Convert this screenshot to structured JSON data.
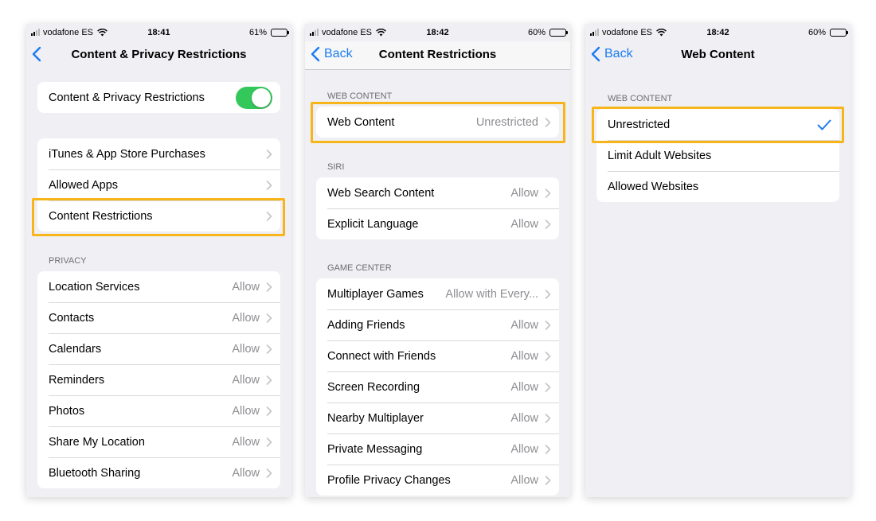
{
  "colors": {
    "accent": "#1a7cf0",
    "toggle_on": "#34c759",
    "highlight": "#f7b519"
  },
  "screens": [
    {
      "status": {
        "carrier": "vodafone ES",
        "time": "18:41",
        "battery_text": "61%",
        "battery_level": 0.61
      },
      "nav": {
        "title": "Content & Privacy Restrictions",
        "back_label": ""
      },
      "toggle_row": {
        "label": "Content & Privacy Restrictions",
        "enabled": true
      },
      "menu": [
        {
          "label": "iTunes & App Store Purchases"
        },
        {
          "label": "Allowed Apps"
        },
        {
          "label": "Content Restrictions"
        }
      ],
      "privacy_header": "PRIVACY",
      "privacy": [
        {
          "label": "Location Services",
          "value": "Allow"
        },
        {
          "label": "Contacts",
          "value": "Allow"
        },
        {
          "label": "Calendars",
          "value": "Allow"
        },
        {
          "label": "Reminders",
          "value": "Allow"
        },
        {
          "label": "Photos",
          "value": "Allow"
        },
        {
          "label": "Share My Location",
          "value": "Allow"
        },
        {
          "label": "Bluetooth Sharing",
          "value": "Allow"
        }
      ]
    },
    {
      "status": {
        "carrier": "vodafone ES",
        "time": "18:42",
        "battery_text": "60%",
        "battery_level": 0.6
      },
      "nav": {
        "title": "Content Restrictions",
        "back_label": "Back"
      },
      "web_header": "WEB CONTENT",
      "web": [
        {
          "label": "Web Content",
          "value": "Unrestricted"
        }
      ],
      "siri_header": "SIRI",
      "siri": [
        {
          "label": "Web Search Content",
          "value": "Allow"
        },
        {
          "label": "Explicit Language",
          "value": "Allow"
        }
      ],
      "game_header": "GAME CENTER",
      "game": [
        {
          "label": "Multiplayer Games",
          "value": "Allow with Every..."
        },
        {
          "label": "Adding Friends",
          "value": "Allow"
        },
        {
          "label": "Connect with Friends",
          "value": "Allow"
        },
        {
          "label": "Screen Recording",
          "value": "Allow"
        },
        {
          "label": "Nearby Multiplayer",
          "value": "Allow"
        },
        {
          "label": "Private Messaging",
          "value": "Allow"
        },
        {
          "label": "Profile Privacy Changes",
          "value": "Allow"
        }
      ]
    },
    {
      "status": {
        "carrier": "vodafone ES",
        "time": "18:42",
        "battery_text": "60%",
        "battery_level": 0.6
      },
      "nav": {
        "title": "Web Content",
        "back_label": "Back"
      },
      "web_header": "WEB CONTENT",
      "options": [
        {
          "label": "Unrestricted",
          "selected": true
        },
        {
          "label": "Limit Adult Websites",
          "selected": false
        },
        {
          "label": "Allowed Websites",
          "selected": false
        }
      ]
    }
  ]
}
